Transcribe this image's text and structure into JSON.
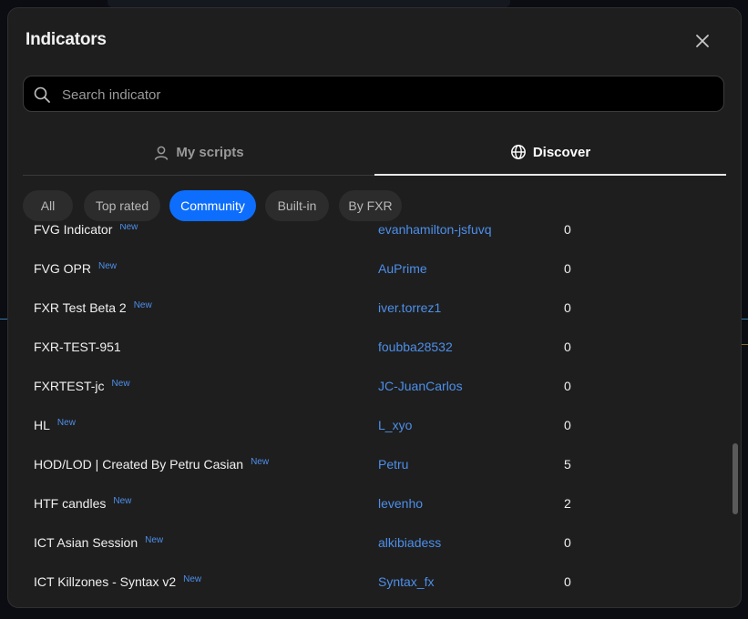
{
  "dialog": {
    "title": "Indicators",
    "close_icon": "close-icon"
  },
  "search": {
    "placeholder": "Search indicator",
    "value": "",
    "icon": "search-icon"
  },
  "tabs": [
    {
      "label": "My scripts",
      "icon": "user-icon",
      "active": false
    },
    {
      "label": "Discover",
      "icon": "globe-icon",
      "active": true
    }
  ],
  "filters": [
    {
      "label": "All",
      "active": false
    },
    {
      "label": "Top rated",
      "active": false
    },
    {
      "label": "Community",
      "active": true
    },
    {
      "label": "Built-in",
      "active": false
    },
    {
      "label": "By FXR",
      "active": false
    }
  ],
  "rows": [
    {
      "name": "FVG Indicator",
      "badge": "New",
      "author": "evanhamilton-jsfuvq",
      "count": "0"
    },
    {
      "name": "FVG OPR",
      "badge": "New",
      "author": "AuPrime",
      "count": "0"
    },
    {
      "name": "FXR Test Beta 2",
      "badge": "New",
      "author": "iver.torrez1",
      "count": "0"
    },
    {
      "name": "FXR-TEST-951",
      "badge": "",
      "author": "foubba28532",
      "count": "0"
    },
    {
      "name": "FXRTEST-jc",
      "badge": "New",
      "author": "JC-JuanCarlos",
      "count": "0"
    },
    {
      "name": "HL",
      "badge": "New",
      "author": "L_xyo",
      "count": "0"
    },
    {
      "name": "HOD/LOD | Created By Petru Casian",
      "badge": "New",
      "author": "Petru",
      "count": "5"
    },
    {
      "name": "HTF candles",
      "badge": "New",
      "author": "levenho",
      "count": "2"
    },
    {
      "name": "ICT Asian Session",
      "badge": "New",
      "author": "alkibiadess",
      "count": "0"
    },
    {
      "name": "ICT Killzones - Syntax v2",
      "badge": "New",
      "author": "Syntax_fx",
      "count": "0"
    }
  ],
  "colors": {
    "accent": "#0d6efd",
    "link": "#4d8fea",
    "panel": "#1e1e1e"
  }
}
